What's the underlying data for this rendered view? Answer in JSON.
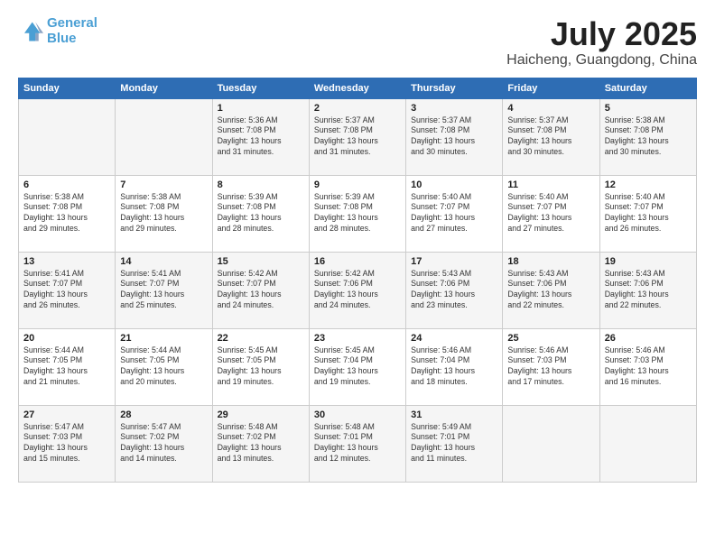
{
  "header": {
    "logo_line1": "General",
    "logo_line2": "Blue",
    "month": "July 2025",
    "location": "Haicheng, Guangdong, China"
  },
  "weekdays": [
    "Sunday",
    "Monday",
    "Tuesday",
    "Wednesday",
    "Thursday",
    "Friday",
    "Saturday"
  ],
  "weeks": [
    [
      {
        "day": "",
        "detail": ""
      },
      {
        "day": "",
        "detail": ""
      },
      {
        "day": "1",
        "detail": "Sunrise: 5:36 AM\nSunset: 7:08 PM\nDaylight: 13 hours\nand 31 minutes."
      },
      {
        "day": "2",
        "detail": "Sunrise: 5:37 AM\nSunset: 7:08 PM\nDaylight: 13 hours\nand 31 minutes."
      },
      {
        "day": "3",
        "detail": "Sunrise: 5:37 AM\nSunset: 7:08 PM\nDaylight: 13 hours\nand 30 minutes."
      },
      {
        "day": "4",
        "detail": "Sunrise: 5:37 AM\nSunset: 7:08 PM\nDaylight: 13 hours\nand 30 minutes."
      },
      {
        "day": "5",
        "detail": "Sunrise: 5:38 AM\nSunset: 7:08 PM\nDaylight: 13 hours\nand 30 minutes."
      }
    ],
    [
      {
        "day": "6",
        "detail": "Sunrise: 5:38 AM\nSunset: 7:08 PM\nDaylight: 13 hours\nand 29 minutes."
      },
      {
        "day": "7",
        "detail": "Sunrise: 5:38 AM\nSunset: 7:08 PM\nDaylight: 13 hours\nand 29 minutes."
      },
      {
        "day": "8",
        "detail": "Sunrise: 5:39 AM\nSunset: 7:08 PM\nDaylight: 13 hours\nand 28 minutes."
      },
      {
        "day": "9",
        "detail": "Sunrise: 5:39 AM\nSunset: 7:08 PM\nDaylight: 13 hours\nand 28 minutes."
      },
      {
        "day": "10",
        "detail": "Sunrise: 5:40 AM\nSunset: 7:07 PM\nDaylight: 13 hours\nand 27 minutes."
      },
      {
        "day": "11",
        "detail": "Sunrise: 5:40 AM\nSunset: 7:07 PM\nDaylight: 13 hours\nand 27 minutes."
      },
      {
        "day": "12",
        "detail": "Sunrise: 5:40 AM\nSunset: 7:07 PM\nDaylight: 13 hours\nand 26 minutes."
      }
    ],
    [
      {
        "day": "13",
        "detail": "Sunrise: 5:41 AM\nSunset: 7:07 PM\nDaylight: 13 hours\nand 26 minutes."
      },
      {
        "day": "14",
        "detail": "Sunrise: 5:41 AM\nSunset: 7:07 PM\nDaylight: 13 hours\nand 25 minutes."
      },
      {
        "day": "15",
        "detail": "Sunrise: 5:42 AM\nSunset: 7:07 PM\nDaylight: 13 hours\nand 24 minutes."
      },
      {
        "day": "16",
        "detail": "Sunrise: 5:42 AM\nSunset: 7:06 PM\nDaylight: 13 hours\nand 24 minutes."
      },
      {
        "day": "17",
        "detail": "Sunrise: 5:43 AM\nSunset: 7:06 PM\nDaylight: 13 hours\nand 23 minutes."
      },
      {
        "day": "18",
        "detail": "Sunrise: 5:43 AM\nSunset: 7:06 PM\nDaylight: 13 hours\nand 22 minutes."
      },
      {
        "day": "19",
        "detail": "Sunrise: 5:43 AM\nSunset: 7:06 PM\nDaylight: 13 hours\nand 22 minutes."
      }
    ],
    [
      {
        "day": "20",
        "detail": "Sunrise: 5:44 AM\nSunset: 7:05 PM\nDaylight: 13 hours\nand 21 minutes."
      },
      {
        "day": "21",
        "detail": "Sunrise: 5:44 AM\nSunset: 7:05 PM\nDaylight: 13 hours\nand 20 minutes."
      },
      {
        "day": "22",
        "detail": "Sunrise: 5:45 AM\nSunset: 7:05 PM\nDaylight: 13 hours\nand 19 minutes."
      },
      {
        "day": "23",
        "detail": "Sunrise: 5:45 AM\nSunset: 7:04 PM\nDaylight: 13 hours\nand 19 minutes."
      },
      {
        "day": "24",
        "detail": "Sunrise: 5:46 AM\nSunset: 7:04 PM\nDaylight: 13 hours\nand 18 minutes."
      },
      {
        "day": "25",
        "detail": "Sunrise: 5:46 AM\nSunset: 7:03 PM\nDaylight: 13 hours\nand 17 minutes."
      },
      {
        "day": "26",
        "detail": "Sunrise: 5:46 AM\nSunset: 7:03 PM\nDaylight: 13 hours\nand 16 minutes."
      }
    ],
    [
      {
        "day": "27",
        "detail": "Sunrise: 5:47 AM\nSunset: 7:03 PM\nDaylight: 13 hours\nand 15 minutes."
      },
      {
        "day": "28",
        "detail": "Sunrise: 5:47 AM\nSunset: 7:02 PM\nDaylight: 13 hours\nand 14 minutes."
      },
      {
        "day": "29",
        "detail": "Sunrise: 5:48 AM\nSunset: 7:02 PM\nDaylight: 13 hours\nand 13 minutes."
      },
      {
        "day": "30",
        "detail": "Sunrise: 5:48 AM\nSunset: 7:01 PM\nDaylight: 13 hours\nand 12 minutes."
      },
      {
        "day": "31",
        "detail": "Sunrise: 5:49 AM\nSunset: 7:01 PM\nDaylight: 13 hours\nand 11 minutes."
      },
      {
        "day": "",
        "detail": ""
      },
      {
        "day": "",
        "detail": ""
      }
    ]
  ]
}
